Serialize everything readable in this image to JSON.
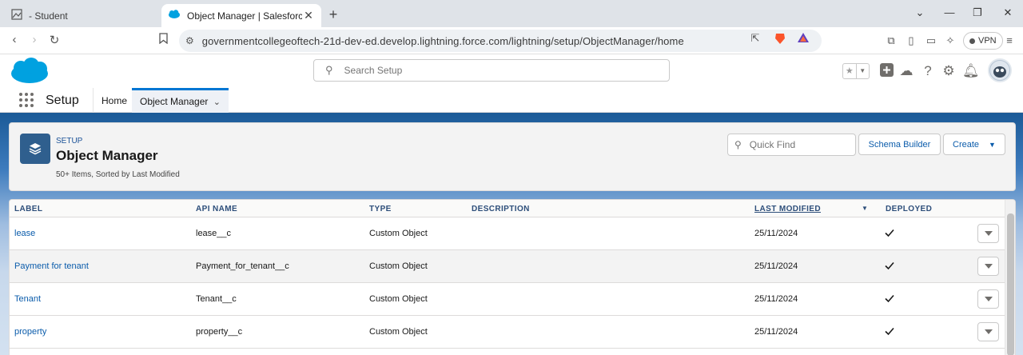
{
  "browser": {
    "tabs": [
      {
        "title": "- Student"
      },
      {
        "title": "Object Manager | Salesforce"
      }
    ],
    "url": "governmentcollegeoftech-21d-dev-ed.develop.lightning.force.com/lightning/setup/ObjectManager/home",
    "vpn_label": "VPN"
  },
  "header": {
    "search_placeholder": "Search Setup"
  },
  "app_nav": {
    "app_name": "Setup",
    "tabs": [
      {
        "label": "Home"
      },
      {
        "label": "Object Manager"
      }
    ]
  },
  "page_header": {
    "eyebrow": "SETUP",
    "title": "Object Manager",
    "meta": "50+ Items, Sorted by Last Modified",
    "quick_find_placeholder": "Quick Find",
    "schema_builder_label": "Schema Builder",
    "create_label": "Create"
  },
  "table": {
    "columns": [
      {
        "label": "LABEL"
      },
      {
        "label": "API NAME"
      },
      {
        "label": "TYPE"
      },
      {
        "label": "DESCRIPTION"
      },
      {
        "label": "LAST MODIFIED"
      },
      {
        "label": "DEPLOYED"
      }
    ],
    "sorted_by": "LAST MODIFIED",
    "rows": [
      {
        "label": "lease",
        "api_name": "lease__c",
        "type": "Custom Object",
        "description": "",
        "last_modified": "25/11/2024",
        "deployed": true
      },
      {
        "label": "Payment for tenant",
        "api_name": "Payment_for_tenant__c",
        "type": "Custom Object",
        "description": "",
        "last_modified": "25/11/2024",
        "deployed": true
      },
      {
        "label": "Tenant",
        "api_name": "Tenant__c",
        "type": "Custom Object",
        "description": "",
        "last_modified": "25/11/2024",
        "deployed": true
      },
      {
        "label": "property",
        "api_name": "property__c",
        "type": "Custom Object",
        "description": "",
        "last_modified": "25/11/2024",
        "deployed": true
      }
    ]
  },
  "colors": {
    "brand_blue": "#0176d3",
    "link_blue": "#0b5cab",
    "salesforce_cloud": "#00a1e0",
    "header_band": "#1b5a97"
  },
  "icons": {
    "tab_favicon": "salesforce-cloud-icon",
    "brave": "brave-lion-icon",
    "page_header": "layers-icon"
  }
}
